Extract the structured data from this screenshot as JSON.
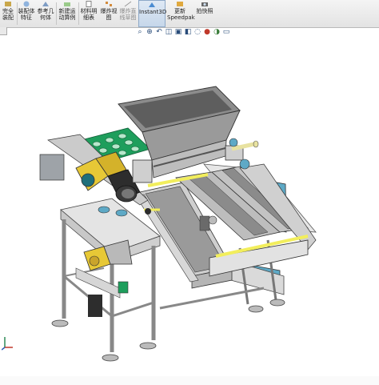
{
  "ribbon": {
    "buttons": [
      {
        "label": "完全装配",
        "sub": "体"
      },
      {
        "label": "装配体",
        "sub": "特征"
      },
      {
        "label": "参考几",
        "sub": "何体"
      },
      {
        "label": "新建运",
        "sub": "动算例"
      },
      {
        "label": "材料明",
        "sub": "细表"
      },
      {
        "label": "爆炸视",
        "sub": "图"
      },
      {
        "label": "爆炸直",
        "sub": "线草图"
      },
      {
        "label": "Instant3D",
        "sub": ""
      },
      {
        "label": "更新",
        "sub": "Speedpak"
      },
      {
        "label": "拍快照",
        "sub": ""
      }
    ]
  },
  "view_toolbar": {
    "icons": [
      "zoom-fit-icon",
      "zoom-area-icon",
      "previous-view-icon",
      "section-view-icon",
      "view-orientation-icon",
      "display-style-icon",
      "hide-show-icon",
      "appearance-icon",
      "scene-icon",
      "display-settings-icon"
    ]
  },
  "colors": {
    "frame": "#dcdcdc",
    "hopper": "#8c8c8c",
    "tray": "#1e9e5c",
    "gearbox": "#e7c836",
    "blue_panel": "#5ea9c6",
    "motor": "#2d2d2d",
    "yellow_rod": "#f2ee5c"
  }
}
